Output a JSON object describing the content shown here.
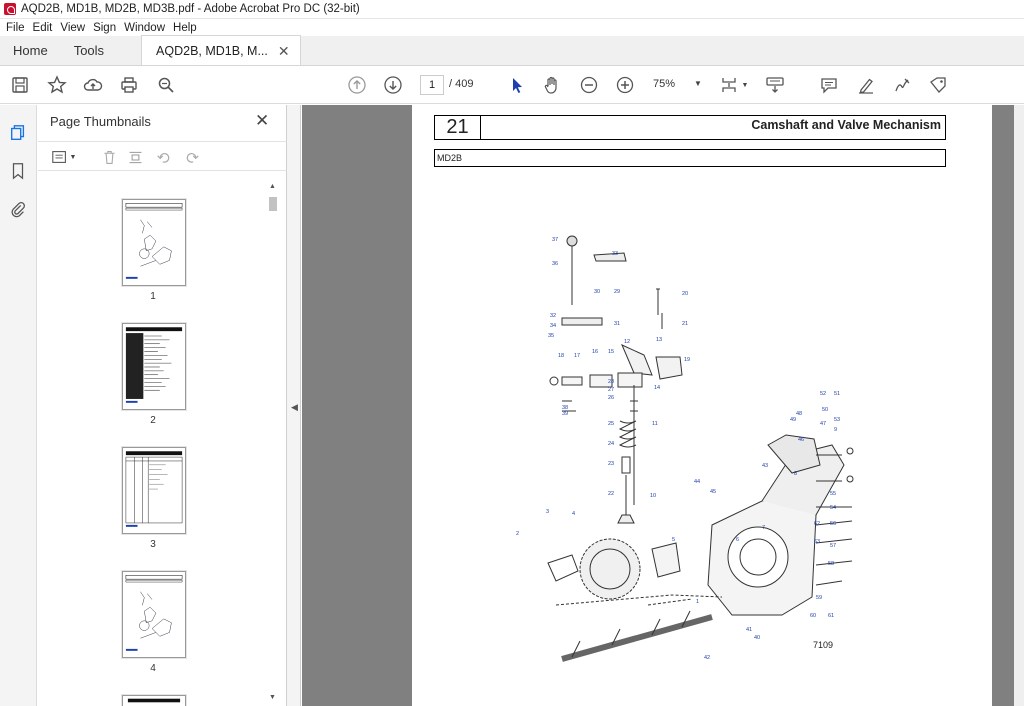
{
  "window": {
    "title": "AQD2B, MD1B, MD2B, MD3B.pdf - Adobe Acrobat Pro DC (32-bit)"
  },
  "menu": [
    "File",
    "Edit",
    "View",
    "Sign",
    "Window",
    "Help"
  ],
  "tabs": {
    "home": "Home",
    "tools": "Tools",
    "document": "AQD2B, MD1B, M..."
  },
  "toolbar": {
    "page_current": "1",
    "page_total": "/ 409",
    "zoom": "75%"
  },
  "thumbnail_panel": {
    "title": "Page Thumbnails",
    "pages": [
      "1",
      "2",
      "3",
      "4"
    ]
  },
  "page": {
    "section_number": "21",
    "section_title": "Camshaft and Valve Mechanism",
    "model": "MD2B",
    "figure_code": "7109",
    "callouts": [
      "37",
      "36",
      "33",
      "30",
      "29",
      "20",
      "32",
      "34",
      "31",
      "21",
      "35",
      "12",
      "13",
      "18",
      "17",
      "16",
      "15",
      "19",
      "28",
      "14",
      "27",
      "26",
      "39",
      "38",
      "11",
      "25",
      "24",
      "23",
      "22",
      "10",
      "44",
      "45",
      "43",
      "49",
      "46",
      "48",
      "52",
      "51",
      "50",
      "47",
      "53",
      "9",
      "8",
      "7",
      "6",
      "5",
      "4",
      "3",
      "2",
      "1",
      "40",
      "41",
      "42",
      "55",
      "54",
      "56",
      "57",
      "58",
      "59",
      "60",
      "61",
      "62",
      "63"
    ]
  },
  "colors": {
    "accent": "#1473e6",
    "callout": "#1f3fae"
  }
}
